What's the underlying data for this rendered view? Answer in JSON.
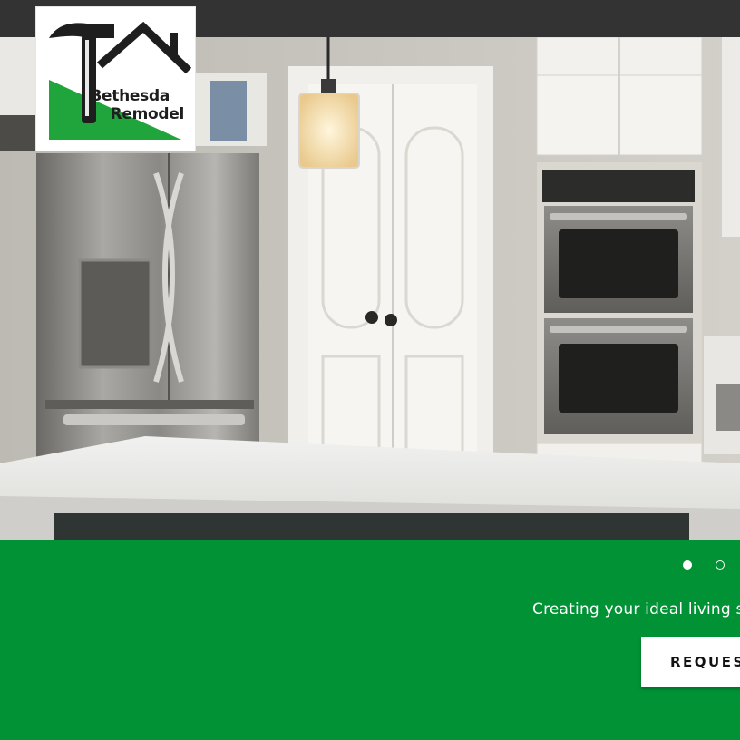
{
  "logo": {
    "line1": "Bethesda",
    "line2": "Remodel",
    "colors": {
      "green": "#1fa53c",
      "dark": "#1e1e1e"
    }
  },
  "hero": {
    "image_description_icon": "kitchen-photo"
  },
  "slideshow": {
    "slide_count": 2,
    "active_slide": 1
  },
  "hero_text": {
    "tagline": "Creating your ideal living sp",
    "cta_label": "REQUEST"
  },
  "colors": {
    "accent_green": "#019235",
    "top_bar": "#333333",
    "button_bg": "#ffffff"
  }
}
